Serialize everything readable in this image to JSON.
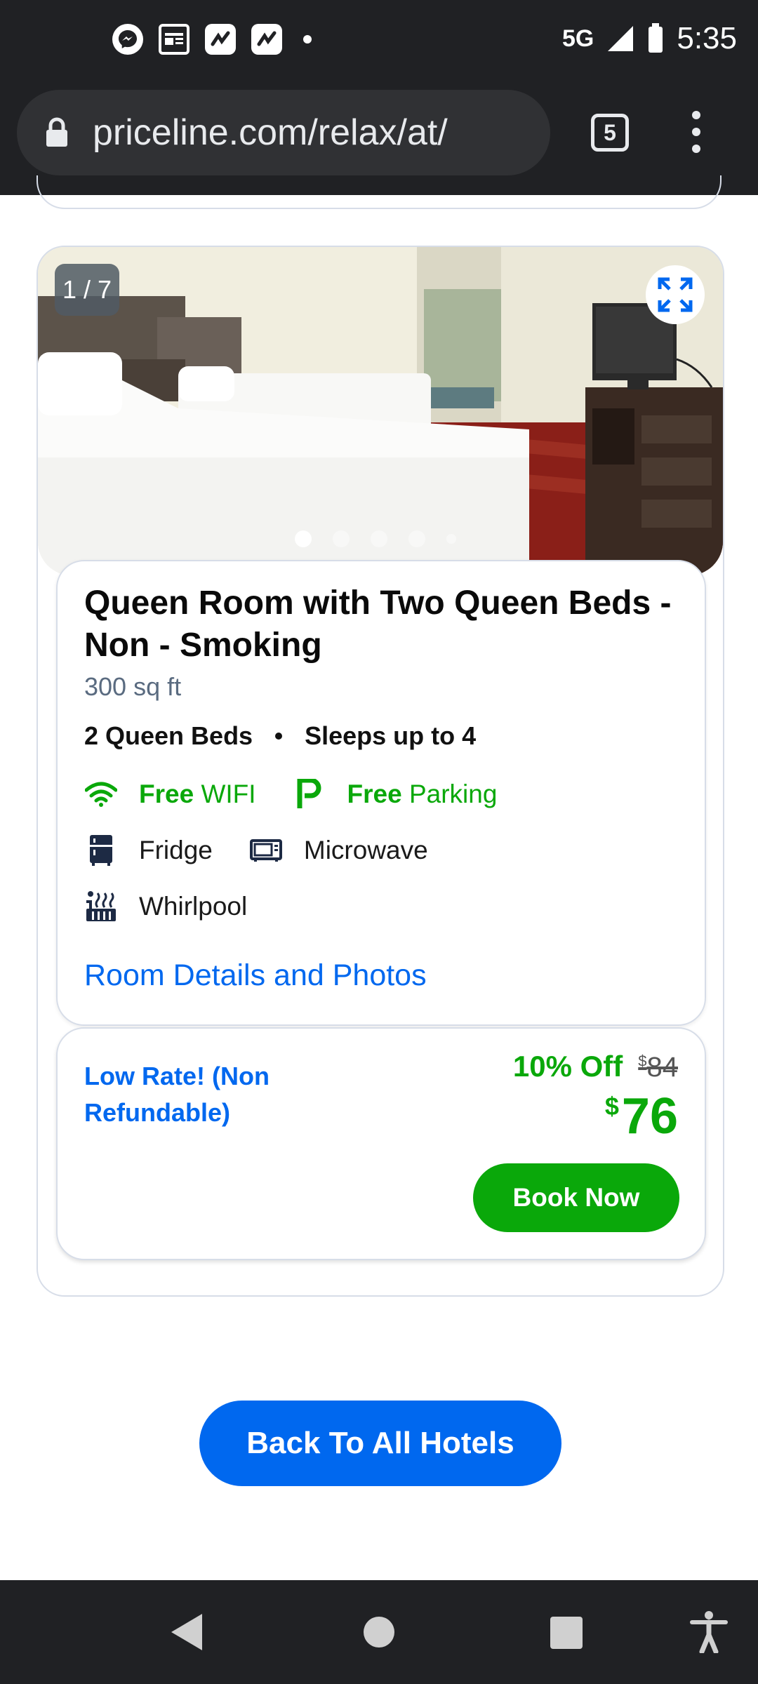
{
  "status_bar": {
    "network": "5G",
    "time": "5:35",
    "notification_icons": [
      "messenger-icon",
      "news-icon",
      "app-icon",
      "app-icon"
    ]
  },
  "browser": {
    "url": "priceline.com/relax/at/",
    "tab_count": "5"
  },
  "room": {
    "photo_counter": "1 / 7",
    "photo_count": 5,
    "active_photo_index": 0,
    "title": "Queen Room with Two Queen Beds - Non - Smoking",
    "size": "300 sq ft",
    "beds": "2 Queen Beds",
    "sleeps": "Sleeps up to 4",
    "amenities": {
      "wifi_free": "Free",
      "wifi_label": "WIFI",
      "parking_free": "Free",
      "parking_label": "Parking",
      "fridge": "Fridge",
      "microwave": "Microwave",
      "whirlpool": "Whirlpool"
    },
    "details_link": "Room Details and Photos"
  },
  "rate": {
    "label": "Low Rate! (Non Refundable)",
    "discount": "10% Off",
    "currency": "$",
    "original_price": "84",
    "price": "76",
    "book_button": "Book Now"
  },
  "back_button": "Back To All Hotels",
  "colors": {
    "brand_blue": "#0068ef",
    "green": "#0aa80a",
    "dark_bar": "#202124"
  }
}
